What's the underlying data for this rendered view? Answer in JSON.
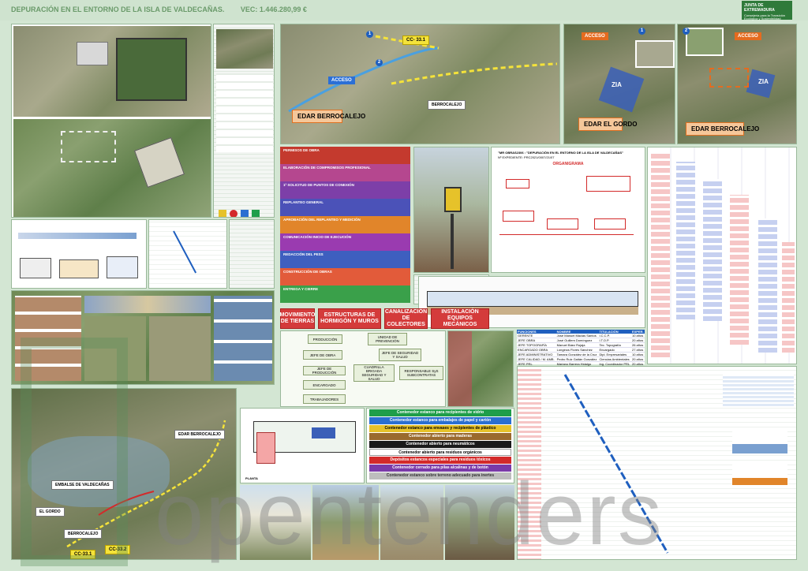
{
  "header": {
    "title": "DEPURACIÓN EN EL ENTORNO DE LA ISLA DE VALDECAÑAS.",
    "vec": "VEC: 1.446.280,99 €",
    "logo_main": "JUNTA DE EXTREMADURA",
    "logo_sub": "Consejería para la Transición Ecológica y Sostenibilidad"
  },
  "map_top": {
    "label_cc": "CC- 33.1",
    "label_acceso": "ACCESO",
    "label_edar": "EDAR BERROCALEJO",
    "label_town": "BERROCALEJO",
    "marker_1": "1",
    "marker_2": "2"
  },
  "site1": {
    "acceso": "ACCESO",
    "zia": "ZIA",
    "edar": "EDAR EL GORDO",
    "marker": "1"
  },
  "site2": {
    "acceso": "ACCESO",
    "zia": "ZIA",
    "edar": "EDAR BERROCALEJO",
    "marker": "2"
  },
  "stages": [
    {
      "title": "PERMISOS DE OBRA",
      "color": "#c43a2e"
    },
    {
      "title": "ELABORACIÓN DE COMPROMISOS PROFESIONAL",
      "color": "#b5478f"
    },
    {
      "title": "1ª SOLICITUD DE PUNTOS DE CONEXIÓN",
      "color": "#7d3fa8"
    },
    {
      "title": "REPLANTEO GENERAL",
      "color": "#4b52b8"
    },
    {
      "title": "APROBACIÓN DEL REPLANTEO Y MEDICIÓN",
      "color": "#e1852a"
    },
    {
      "title": "COMUNICACIÓN INICIO DE EJECUCIÓN",
      "color": "#9a3bb0"
    },
    {
      "title": "REDACCIÓN DEL PESS",
      "color": "#3e5fbf"
    },
    {
      "title": "CONSTRUCCIÓN DE OBRAS",
      "color": "#e25b3a"
    },
    {
      "title": "ENTREGA Y CIERRE",
      "color": "#3aa04a"
    }
  ],
  "categories": [
    {
      "label": "MOVIMIENTO DE TIERRAS"
    },
    {
      "label": "ESTRUCTURAS DE HORMIGÓN Y MUROS"
    },
    {
      "label": "CANALIZACIÓN DE COLECTORES"
    },
    {
      "label": "INSTALACIÓN EQUIPOS MECÁNICOS"
    }
  ],
  "orgchart": {
    "doc_title": "\"MR OBRAS2306 : \"DEPURACIÓN EN EL ENTORNO DE LA ISLA DE VALDECAÑAS\"",
    "doc_exp": "Nº EXPEDIENTE: PRC2021/0007/21/07",
    "heading": "ORGANIGRAMA"
  },
  "team": {
    "headers": [
      "FUNCIONES",
      "NOMBRE",
      "TITULACIÓN",
      "EXPER."
    ],
    "rows": [
      [
        "GERENTE",
        "José Manuel Macias Santos",
        "I.C.C.P.",
        "10 años"
      ],
      [
        "JEFE OBRA",
        "José Guillem Domínguez",
        "I.T.O.P.",
        "20 años"
      ],
      [
        "JEFE TOPOGRAFÍA",
        "Manuel Báez Rojaja",
        "Tec. Topografía",
        "26 años"
      ],
      [
        "ENCARGADO OBRA",
        "Longinos Flores Sánchez",
        "Encargado",
        "27 años"
      ],
      [
        "JEFE ADMINISTRATIVO",
        "Tamara González de la Cruz",
        "Dipl. Empresariales",
        "10 años"
      ],
      [
        "JEFE CALIDAD / M. AMB.",
        "Pedro Ruiz Gaitán González",
        "Ciencias Ambientales",
        "20 años"
      ],
      [
        "JEFE PRL",
        "Mariano Barrera Hidalgo",
        "Ing. Coordinador PRL",
        "20 años"
      ]
    ]
  },
  "org_boxes": {
    "produccion": "PRODUCCIÓN",
    "unidad": "UNIDAD DE PREVENCIÓN",
    "jefe_obra": "JEFE DE OBRA",
    "jefe_seg": "JEFE DE SEGURIDAD Y SALUD",
    "jefe_prod": "JEFE DE PRODUCCIÓN",
    "cuadrilla": "CUADRILLA BRIGADA SEGURIDAD Y SALUD",
    "responsable": "RESPONSABLE SyS SUBCONTRATAS",
    "encargado": "ENCARGADO",
    "trabajadores": "TRABAJADORES"
  },
  "bins": [
    {
      "label": "Contenedor estanco para recipientes de vidrio",
      "color": "#1f9e4a"
    },
    {
      "label": "Contenedor estanco para embalajes de papel y cartón",
      "color": "#2a6fd1"
    },
    {
      "label": "Contenedor estanco para envases y recipientes de plástico",
      "color": "#e6c22a"
    },
    {
      "label": "Contenedor abierto para maderas",
      "color": "#9a6a2e"
    },
    {
      "label": "Contenedor abierto para neumáticos",
      "color": "#1a1a1a"
    },
    {
      "label": "Contenedor abierto para residuos orgánicos",
      "color": "#ffffff"
    },
    {
      "label": "Depósitos estancos especiales para residuos tóxicos",
      "color": "#d32a2a"
    },
    {
      "label": "Contenedor cerrado para pilas alcalinas y de botón",
      "color": "#7a3aa8"
    },
    {
      "label": "Contenedor estanco sobre terreno adecuado para inertes",
      "color": "#bdbdbd"
    }
  ],
  "lower_map": {
    "cc1": "CC-33.1",
    "cc2": "CC-33.2",
    "edar": "EDAR BERROCALEJO",
    "gordo": "EL GORDO",
    "berrocalejo": "BERROCALEJO",
    "embalse": "EMBALSE DE VALDECAÑAS"
  },
  "layout_plan_label": "PLANTA",
  "watermark": "opentenders"
}
